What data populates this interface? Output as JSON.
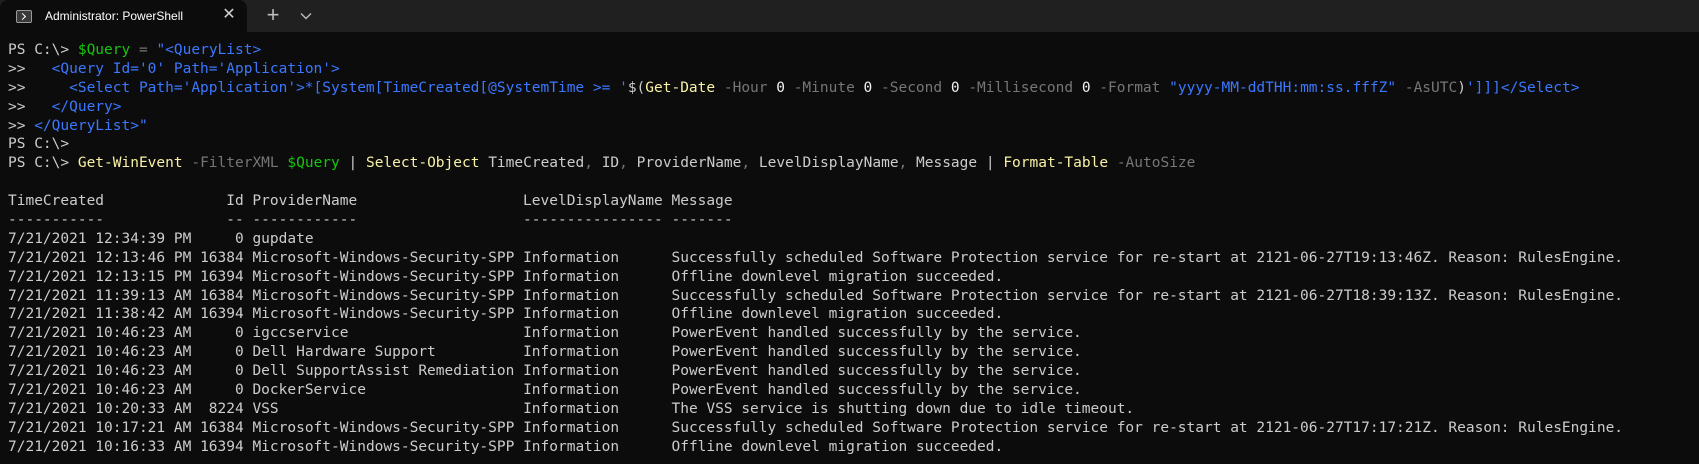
{
  "window": {
    "tab_title": "Administrator: PowerShell",
    "icons": {
      "tab": "powershell-icon",
      "close": "close-icon",
      "new_tab": "plus-icon",
      "dropdown": "chevron-down-icon"
    },
    "new_tab_label": "+",
    "close_label": "✕"
  },
  "colors": {
    "background": "#0c0c0c",
    "titlebar": "#202020",
    "text": "#cccccc",
    "variable": "#16c60c",
    "string": "#3b78ff",
    "command": "#f9f1a5",
    "parameter": "#767676",
    "number": "#f2f2f2"
  },
  "console": {
    "query_lines": [
      [
        {
          "t": "PS C:\\> ",
          "c": ""
        },
        {
          "t": "$Query",
          "c": "g"
        },
        {
          "t": " = ",
          "c": "gr"
        },
        {
          "t": "\"<QueryList>",
          "c": "b"
        }
      ],
      [
        {
          "t": ">>   ",
          "c": ""
        },
        {
          "t": "<Query Id='0' Path='Application'>",
          "c": "b"
        }
      ],
      [
        {
          "t": ">>     ",
          "c": ""
        },
        {
          "t": "<Select Path='Application'>*[System[TimeCreated[@SystemTime >= '",
          "c": "b"
        },
        {
          "t": "$(",
          "c": ""
        },
        {
          "t": "Get-Date",
          "c": "y"
        },
        {
          "t": " -Hour ",
          "c": "gr"
        },
        {
          "t": "0",
          "c": "w"
        },
        {
          "t": " -Minute ",
          "c": "gr"
        },
        {
          "t": "0",
          "c": "w"
        },
        {
          "t": " -Second ",
          "c": "gr"
        },
        {
          "t": "0",
          "c": "w"
        },
        {
          "t": " -Millisecond ",
          "c": "gr"
        },
        {
          "t": "0",
          "c": "w"
        },
        {
          "t": " -Format ",
          "c": "gr"
        },
        {
          "t": "\"yyyy-MM-ddTHH:mm:ss.fffZ\"",
          "c": "b"
        },
        {
          "t": " -AsUTC",
          "c": "gr"
        },
        {
          "t": ")",
          "c": ""
        },
        {
          "t": "']]]</Select>",
          "c": "b"
        }
      ],
      [
        {
          "t": ">>   ",
          "c": ""
        },
        {
          "t": "</Query>",
          "c": "b"
        }
      ],
      [
        {
          "t": ">> ",
          "c": ""
        },
        {
          "t": "</QueryList>\"",
          "c": "b"
        }
      ],
      [
        {
          "t": "PS C:\\>",
          "c": ""
        }
      ],
      [
        {
          "t": "PS C:\\> ",
          "c": ""
        },
        {
          "t": "Get-WinEvent",
          "c": "y"
        },
        {
          "t": " -FilterXML ",
          "c": "gr"
        },
        {
          "t": "$Query",
          "c": "g"
        },
        {
          "t": " | ",
          "c": ""
        },
        {
          "t": "Select-Object",
          "c": "y"
        },
        {
          "t": " TimeCreated",
          "c": ""
        },
        {
          "t": ",",
          "c": "gr"
        },
        {
          "t": " ID",
          "c": ""
        },
        {
          "t": ",",
          "c": "gr"
        },
        {
          "t": " ProviderName",
          "c": ""
        },
        {
          "t": ",",
          "c": "gr"
        },
        {
          "t": " LevelDisplayName",
          "c": ""
        },
        {
          "t": ",",
          "c": "gr"
        },
        {
          "t": " Message ",
          "c": ""
        },
        {
          "t": "| ",
          "c": ""
        },
        {
          "t": "Format-Table",
          "c": "y"
        },
        {
          "t": " -AutoSize",
          "c": "gr"
        }
      ]
    ],
    "table": {
      "columns": [
        "TimeCreated",
        "Id",
        "ProviderName",
        "LevelDisplayName",
        "Message"
      ],
      "header_line": "TimeCreated              Id ProviderName                   LevelDisplayName Message",
      "separator_line": "-----------              -- ------------                   ---------------- -------",
      "rows": [
        {
          "time": "7/21/2021 12:34:39 PM",
          "id": "0",
          "provider": "gupdate",
          "level": "",
          "message": ""
        },
        {
          "time": "7/21/2021 12:13:46 PM",
          "id": "16384",
          "provider": "Microsoft-Windows-Security-SPP",
          "level": "Information",
          "message": "Successfully scheduled Software Protection service for re-start at 2121-06-27T19:13:46Z. Reason: RulesEngine."
        },
        {
          "time": "7/21/2021 12:13:15 PM",
          "id": "16394",
          "provider": "Microsoft-Windows-Security-SPP",
          "level": "Information",
          "message": "Offline downlevel migration succeeded."
        },
        {
          "time": "7/21/2021 11:39:13 AM",
          "id": "16384",
          "provider": "Microsoft-Windows-Security-SPP",
          "level": "Information",
          "message": "Successfully scheduled Software Protection service for re-start at 2121-06-27T18:39:13Z. Reason: RulesEngine."
        },
        {
          "time": "7/21/2021 11:38:42 AM",
          "id": "16394",
          "provider": "Microsoft-Windows-Security-SPP",
          "level": "Information",
          "message": "Offline downlevel migration succeeded."
        },
        {
          "time": "7/21/2021 10:46:23 AM",
          "id": "0",
          "provider": "igccservice",
          "level": "Information",
          "message": "PowerEvent handled successfully by the service."
        },
        {
          "time": "7/21/2021 10:46:23 AM",
          "id": "0",
          "provider": "Dell Hardware Support",
          "level": "Information",
          "message": "PowerEvent handled successfully by the service."
        },
        {
          "time": "7/21/2021 10:46:23 AM",
          "id": "0",
          "provider": "Dell SupportAssist Remediation",
          "level": "Information",
          "message": "PowerEvent handled successfully by the service."
        },
        {
          "time": "7/21/2021 10:46:23 AM",
          "id": "0",
          "provider": "DockerService",
          "level": "Information",
          "message": "PowerEvent handled successfully by the service."
        },
        {
          "time": "7/21/2021 10:20:33 AM",
          "id": "8224",
          "provider": "VSS",
          "level": "Information",
          "message": "The VSS service is shutting down due to idle timeout."
        },
        {
          "time": "7/21/2021 10:17:21 AM",
          "id": "16384",
          "provider": "Microsoft-Windows-Security-SPP",
          "level": "Information",
          "message": "Successfully scheduled Software Protection service for re-start at 2121-06-27T17:17:21Z. Reason: RulesEngine."
        },
        {
          "time": "7/21/2021 10:16:33 AM",
          "id": "16394",
          "provider": "Microsoft-Windows-Security-SPP",
          "level": "Information",
          "message": "Offline downlevel migration succeeded."
        }
      ]
    }
  }
}
